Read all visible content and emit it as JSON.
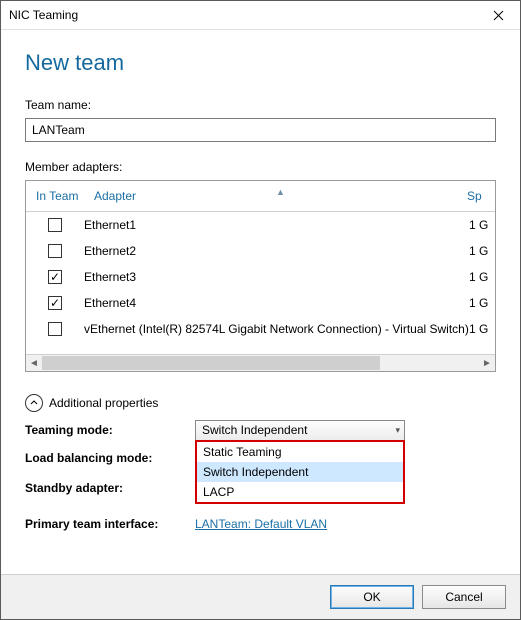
{
  "window": {
    "title": "NIC Teaming"
  },
  "header": {
    "page_title": "New team"
  },
  "team_name": {
    "label": "Team name:",
    "value": "LANTeam"
  },
  "adapters": {
    "label": "Member adapters:",
    "columns": {
      "in_team": "In Team",
      "adapter": "Adapter",
      "speed": "Speed"
    },
    "speed_visible": "Sp",
    "rows": [
      {
        "checked": false,
        "adapter": "Ethernet1",
        "speed": "1 G"
      },
      {
        "checked": false,
        "adapter": "Ethernet2",
        "speed": "1 G"
      },
      {
        "checked": true,
        "adapter": "Ethernet3",
        "speed": "1 G"
      },
      {
        "checked": true,
        "adapter": "Ethernet4",
        "speed": "1 G"
      },
      {
        "checked": false,
        "adapter": "vEthernet (Intel(R) 82574L Gigabit Network Connection) - Virtual Switch)",
        "speed": "1 G"
      }
    ]
  },
  "additional": {
    "header": "Additional properties",
    "teaming_mode": {
      "label": "Teaming mode:",
      "value": "Switch Independent",
      "options": [
        "Static Teaming",
        "Switch Independent",
        "LACP"
      ],
      "selected_index": 1
    },
    "load_balancing": {
      "label": "Load balancing mode:"
    },
    "standby_adapter": {
      "label": "Standby adapter:"
    },
    "primary_interface": {
      "label": "Primary team interface:",
      "link_text": "LANTeam: Default VLAN"
    }
  },
  "footer": {
    "ok": "OK",
    "cancel": "Cancel"
  }
}
